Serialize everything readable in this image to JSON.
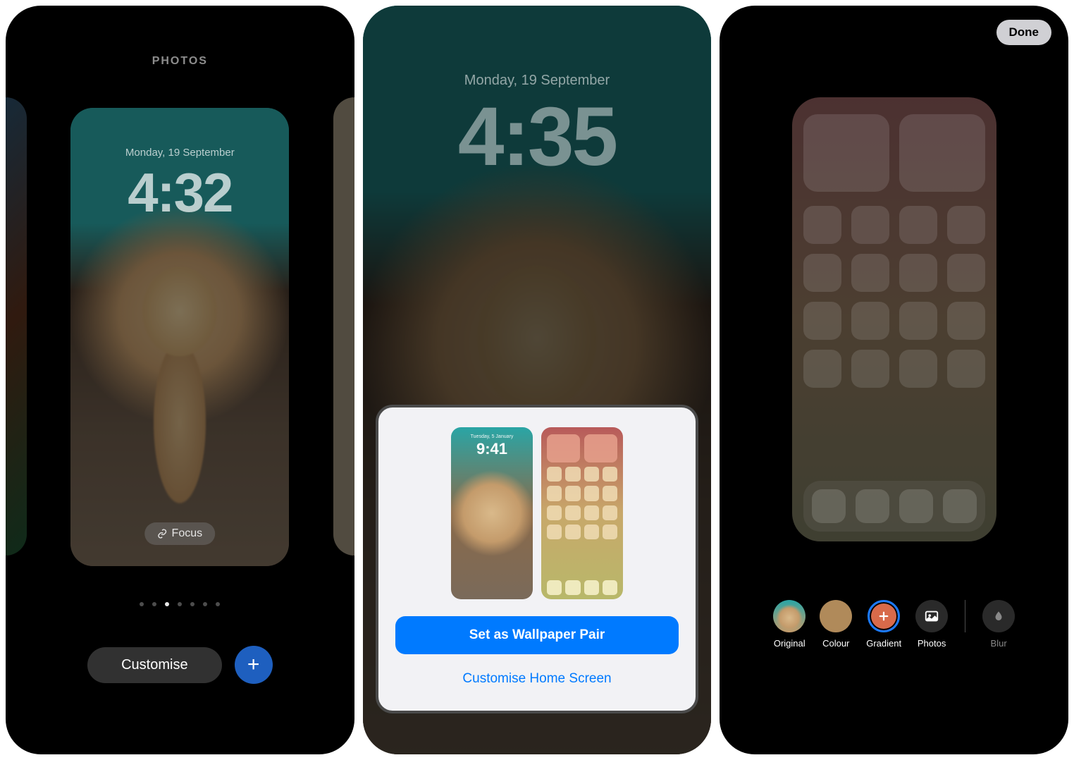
{
  "screen1": {
    "header": "PHOTOS",
    "card": {
      "date": "Monday, 19 September",
      "time": "4:32",
      "focus": "Focus"
    },
    "pagination": {
      "count": 7,
      "active_index": 2
    },
    "customise_label": "Customise",
    "add_label": "+"
  },
  "screen2": {
    "date": "Monday, 19 September",
    "time": "4:35",
    "thumb_lock": {
      "date": "Tuesday, 5 January",
      "time": "9:41"
    },
    "primary_button": "Set as Wallpaper Pair",
    "secondary_button": "Customise Home Screen"
  },
  "screen3": {
    "done": "Done",
    "options": {
      "original": "Original",
      "colour": "Colour",
      "gradient": "Gradient",
      "photos": "Photos",
      "blur": "Blur"
    },
    "selected_option": "gradient"
  },
  "colors": {
    "ios_blue": "#007aff",
    "add_button_blue": "#1e5fbf",
    "colour_swatch": "#b08a5a",
    "gradient_swatch": "#d86a4a"
  }
}
